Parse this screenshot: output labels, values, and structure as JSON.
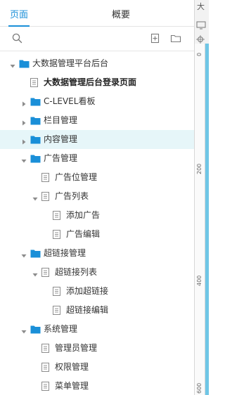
{
  "tabs": {
    "pages": "页面",
    "overview": "概要"
  },
  "toolbar": {
    "search_icon": "search-icon",
    "add_page_icon": "add-page-icon",
    "add_folder_icon": "add-folder-icon"
  },
  "tree": [
    {
      "label": "大数据管理平台后台",
      "type": "folder",
      "expanded": true,
      "depth": 0
    },
    {
      "label": "大数据管理后台登录页面",
      "type": "page",
      "depth": 1,
      "bold": true
    },
    {
      "label": "C-LEVEL看板",
      "type": "folder",
      "expanded": false,
      "depth": 1
    },
    {
      "label": "栏目管理",
      "type": "folder",
      "expanded": false,
      "depth": 1
    },
    {
      "label": "内容管理",
      "type": "folder",
      "expanded": false,
      "depth": 1,
      "selected": true
    },
    {
      "label": "广告管理",
      "type": "folder",
      "expanded": true,
      "depth": 1
    },
    {
      "label": "广告位管理",
      "type": "page",
      "depth": 2
    },
    {
      "label": "广告列表",
      "type": "page",
      "expanded": true,
      "depth": 2
    },
    {
      "label": "添加广告",
      "type": "page",
      "depth": 3
    },
    {
      "label": "广告编辑",
      "type": "page",
      "depth": 3
    },
    {
      "label": "超链接管理",
      "type": "folder",
      "expanded": true,
      "depth": 1
    },
    {
      "label": "超链接列表",
      "type": "page",
      "expanded": true,
      "depth": 2
    },
    {
      "label": "添加超链接",
      "type": "page",
      "depth": 3
    },
    {
      "label": "超链接编辑",
      "type": "page",
      "depth": 3
    },
    {
      "label": "系统管理",
      "type": "folder",
      "expanded": true,
      "depth": 1
    },
    {
      "label": "管理员管理",
      "type": "page",
      "depth": 2
    },
    {
      "label": "权限管理",
      "type": "page",
      "depth": 2
    },
    {
      "label": "菜单管理",
      "type": "page",
      "depth": 2
    }
  ],
  "ruler": {
    "title": "大",
    "marks": [
      "0",
      "200",
      "400",
      "600"
    ]
  },
  "colors": {
    "accent": "#1a8fd8",
    "folder": "#1a8fd8",
    "selected_row": "#e6f6f9"
  }
}
